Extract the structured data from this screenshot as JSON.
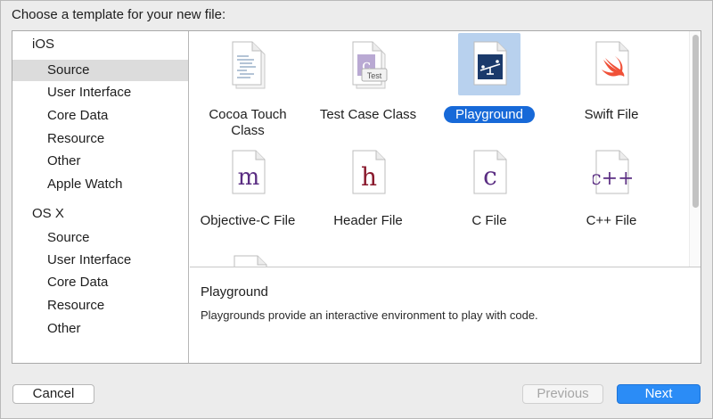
{
  "dialog": {
    "title": "Choose a template for your new file:"
  },
  "sidebar": {
    "groups": [
      {
        "label": "iOS",
        "items": [
          "Source",
          "User Interface",
          "Core Data",
          "Resource",
          "Other",
          "Apple Watch"
        ]
      },
      {
        "label": "OS X",
        "items": [
          "Source",
          "User Interface",
          "Core Data",
          "Resource",
          "Other"
        ]
      }
    ],
    "selected": "iOS / Source"
  },
  "templates": [
    {
      "label": "Cocoa Touch",
      "label2": "Class",
      "icon": "cocoa-touch-class-file-icon"
    },
    {
      "label": "Test Case Class",
      "icon": "test-case-class-file-icon",
      "badge": "Test",
      "glyph": "c"
    },
    {
      "label": "Playground",
      "icon": "playground-icon",
      "selected": true
    },
    {
      "label": "Swift File",
      "icon": "swift-file-icon"
    },
    {
      "label": "Objective-C File",
      "icon": "objective-c-file-icon",
      "glyph": "m"
    },
    {
      "label": "Header File",
      "icon": "header-file-icon",
      "glyph": "h"
    },
    {
      "label": "C File",
      "icon": "c-file-icon",
      "glyph": "c"
    },
    {
      "label": "C++ File",
      "icon": "cpp-file-icon",
      "glyph": "c++"
    }
  ],
  "description": {
    "title": "Playground",
    "body": "Playgrounds provide an interactive environment to play with code."
  },
  "buttons": {
    "cancel": "Cancel",
    "previous": "Previous",
    "next": "Next"
  },
  "colors": {
    "accent": "#1769d8",
    "selection_bg": "#b8d1ee",
    "glyph_purple": "#5a2d82",
    "header_red": "#8a1a2e",
    "swift_orange": "#f05138"
  }
}
